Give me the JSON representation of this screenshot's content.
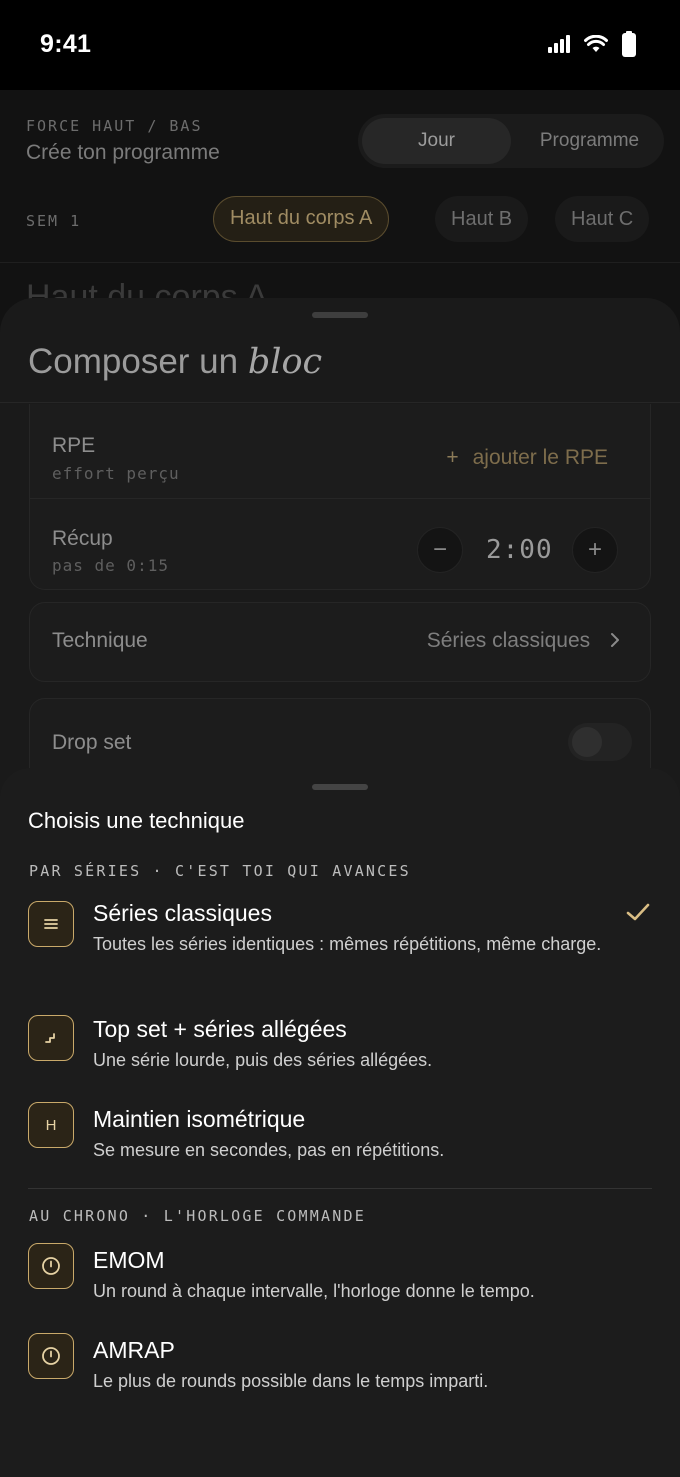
{
  "status_bar": {
    "time": "9:41"
  },
  "background": {
    "breadcrumb": "FORCE HAUT / BAS",
    "subtitle": "Crée ton programme",
    "view_tabs": [
      "Jour",
      "Programme"
    ],
    "week_label": "SEM 1",
    "session_chips": [
      "Haut du corps A",
      "Haut B",
      "Haut C"
    ],
    "heading": "Haut du corps A"
  },
  "composer": {
    "title_plain": "Composer un",
    "title_italic": "bloc",
    "rpe": {
      "label": "RPE",
      "sub": "effort perçu",
      "action": "ajouter le RPE",
      "action_plus": "+"
    },
    "recup": {
      "label": "Récup",
      "sub": "pas de 0:15",
      "value": "2:00",
      "minus": "−",
      "plus": "+"
    },
    "technique": {
      "label": "Technique",
      "value": "Séries classiques"
    },
    "drop_set": {
      "label": "Drop set",
      "enabled": false
    }
  },
  "picker": {
    "title": "Choisis une technique",
    "section1": "PAR SÉRIES · C'EST TOI QUI AVANCES",
    "section2": "AU CHRONO · L'HORLOGE COMMANDE",
    "options": [
      {
        "name": "Séries classiques",
        "desc": "Toutes les séries identiques : mêmes répétitions, même charge.",
        "icon": "lines-icon",
        "selected": true
      },
      {
        "name": "Top set + séries allégées",
        "desc": "Une série lourde, puis des séries allégées.",
        "icon": "steps-icon",
        "selected": false
      },
      {
        "name": "Maintien isométrique",
        "desc": "Se mesure en secondes, pas en répétitions.",
        "icon": "H",
        "selected": false
      },
      {
        "name": "EMOM",
        "desc": "Un round à chaque intervalle, l'horloge donne le tempo.",
        "icon": "clock-icon",
        "selected": false
      },
      {
        "name": "AMRAP",
        "desc": "Le plus de rounds possible dans le temps imparti.",
        "icon": "clock-icon",
        "selected": false
      }
    ],
    "accent": "#c9a96a"
  }
}
